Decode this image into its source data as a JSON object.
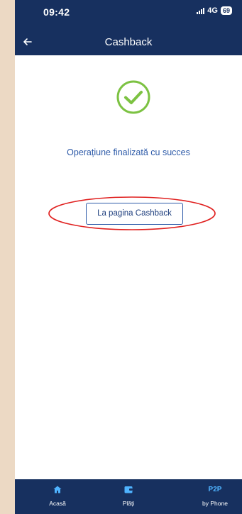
{
  "status": {
    "time": "09:42",
    "network": "4G",
    "battery": "69"
  },
  "header": {
    "title": "Cashback"
  },
  "main": {
    "message": "Operațiune finalizată cu succes",
    "button_label": "La pagina Cashback"
  },
  "tabbar": {
    "items": [
      {
        "label": "Acasă",
        "icon": "home-icon"
      },
      {
        "label": "Plăți",
        "icon": "wallet-icon"
      },
      {
        "badge": "P2P",
        "label": "by Phone",
        "icon": "p2p-icon"
      }
    ]
  },
  "colors": {
    "navy": "#17305f",
    "accent_blue": "#2d5aa8",
    "success_green": "#7cc242",
    "highlight_red": "#e0201f",
    "p2p_blue": "#4fb3ff"
  }
}
